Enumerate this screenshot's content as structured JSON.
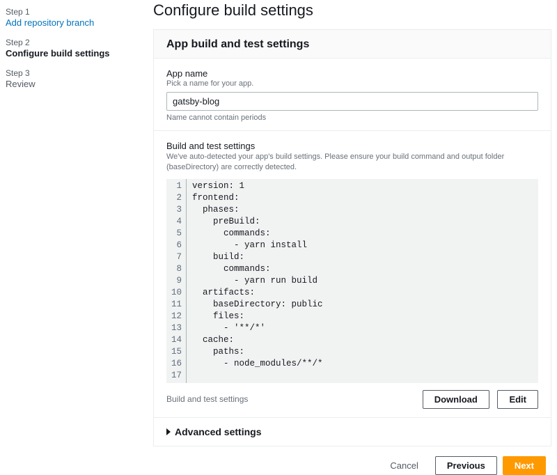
{
  "sidebar": {
    "steps": [
      {
        "num": "Step 1",
        "label": "Add repository branch"
      },
      {
        "num": "Step 2",
        "label": "Configure build settings"
      },
      {
        "num": "Step 3",
        "label": "Review"
      }
    ]
  },
  "page": {
    "title": "Configure build settings"
  },
  "panel": {
    "title": "App build and test settings"
  },
  "appName": {
    "label": "App name",
    "hint": "Pick a name for your app.",
    "value": "gatsby-blog",
    "error": "Name cannot contain periods"
  },
  "buildSettings": {
    "label": "Build and test settings",
    "hint": "We've auto-detected your app's build settings. Please ensure your build command and output folder (baseDirectory) are correctly detected.",
    "lines": [
      "version: 1",
      "frontend:",
      "  phases:",
      "    preBuild:",
      "      commands:",
      "        - yarn install",
      "    build:",
      "      commands:",
      "        - yarn run build",
      "  artifacts:",
      "    baseDirectory: public",
      "    files:",
      "      - '**/*'",
      "  cache:",
      "    paths:",
      "      - node_modules/**/*",
      ""
    ],
    "footerLabel": "Build and test settings",
    "downloadLabel": "Download",
    "editLabel": "Edit"
  },
  "advanced": {
    "label": "Advanced settings"
  },
  "footer": {
    "cancel": "Cancel",
    "previous": "Previous",
    "next": "Next"
  }
}
